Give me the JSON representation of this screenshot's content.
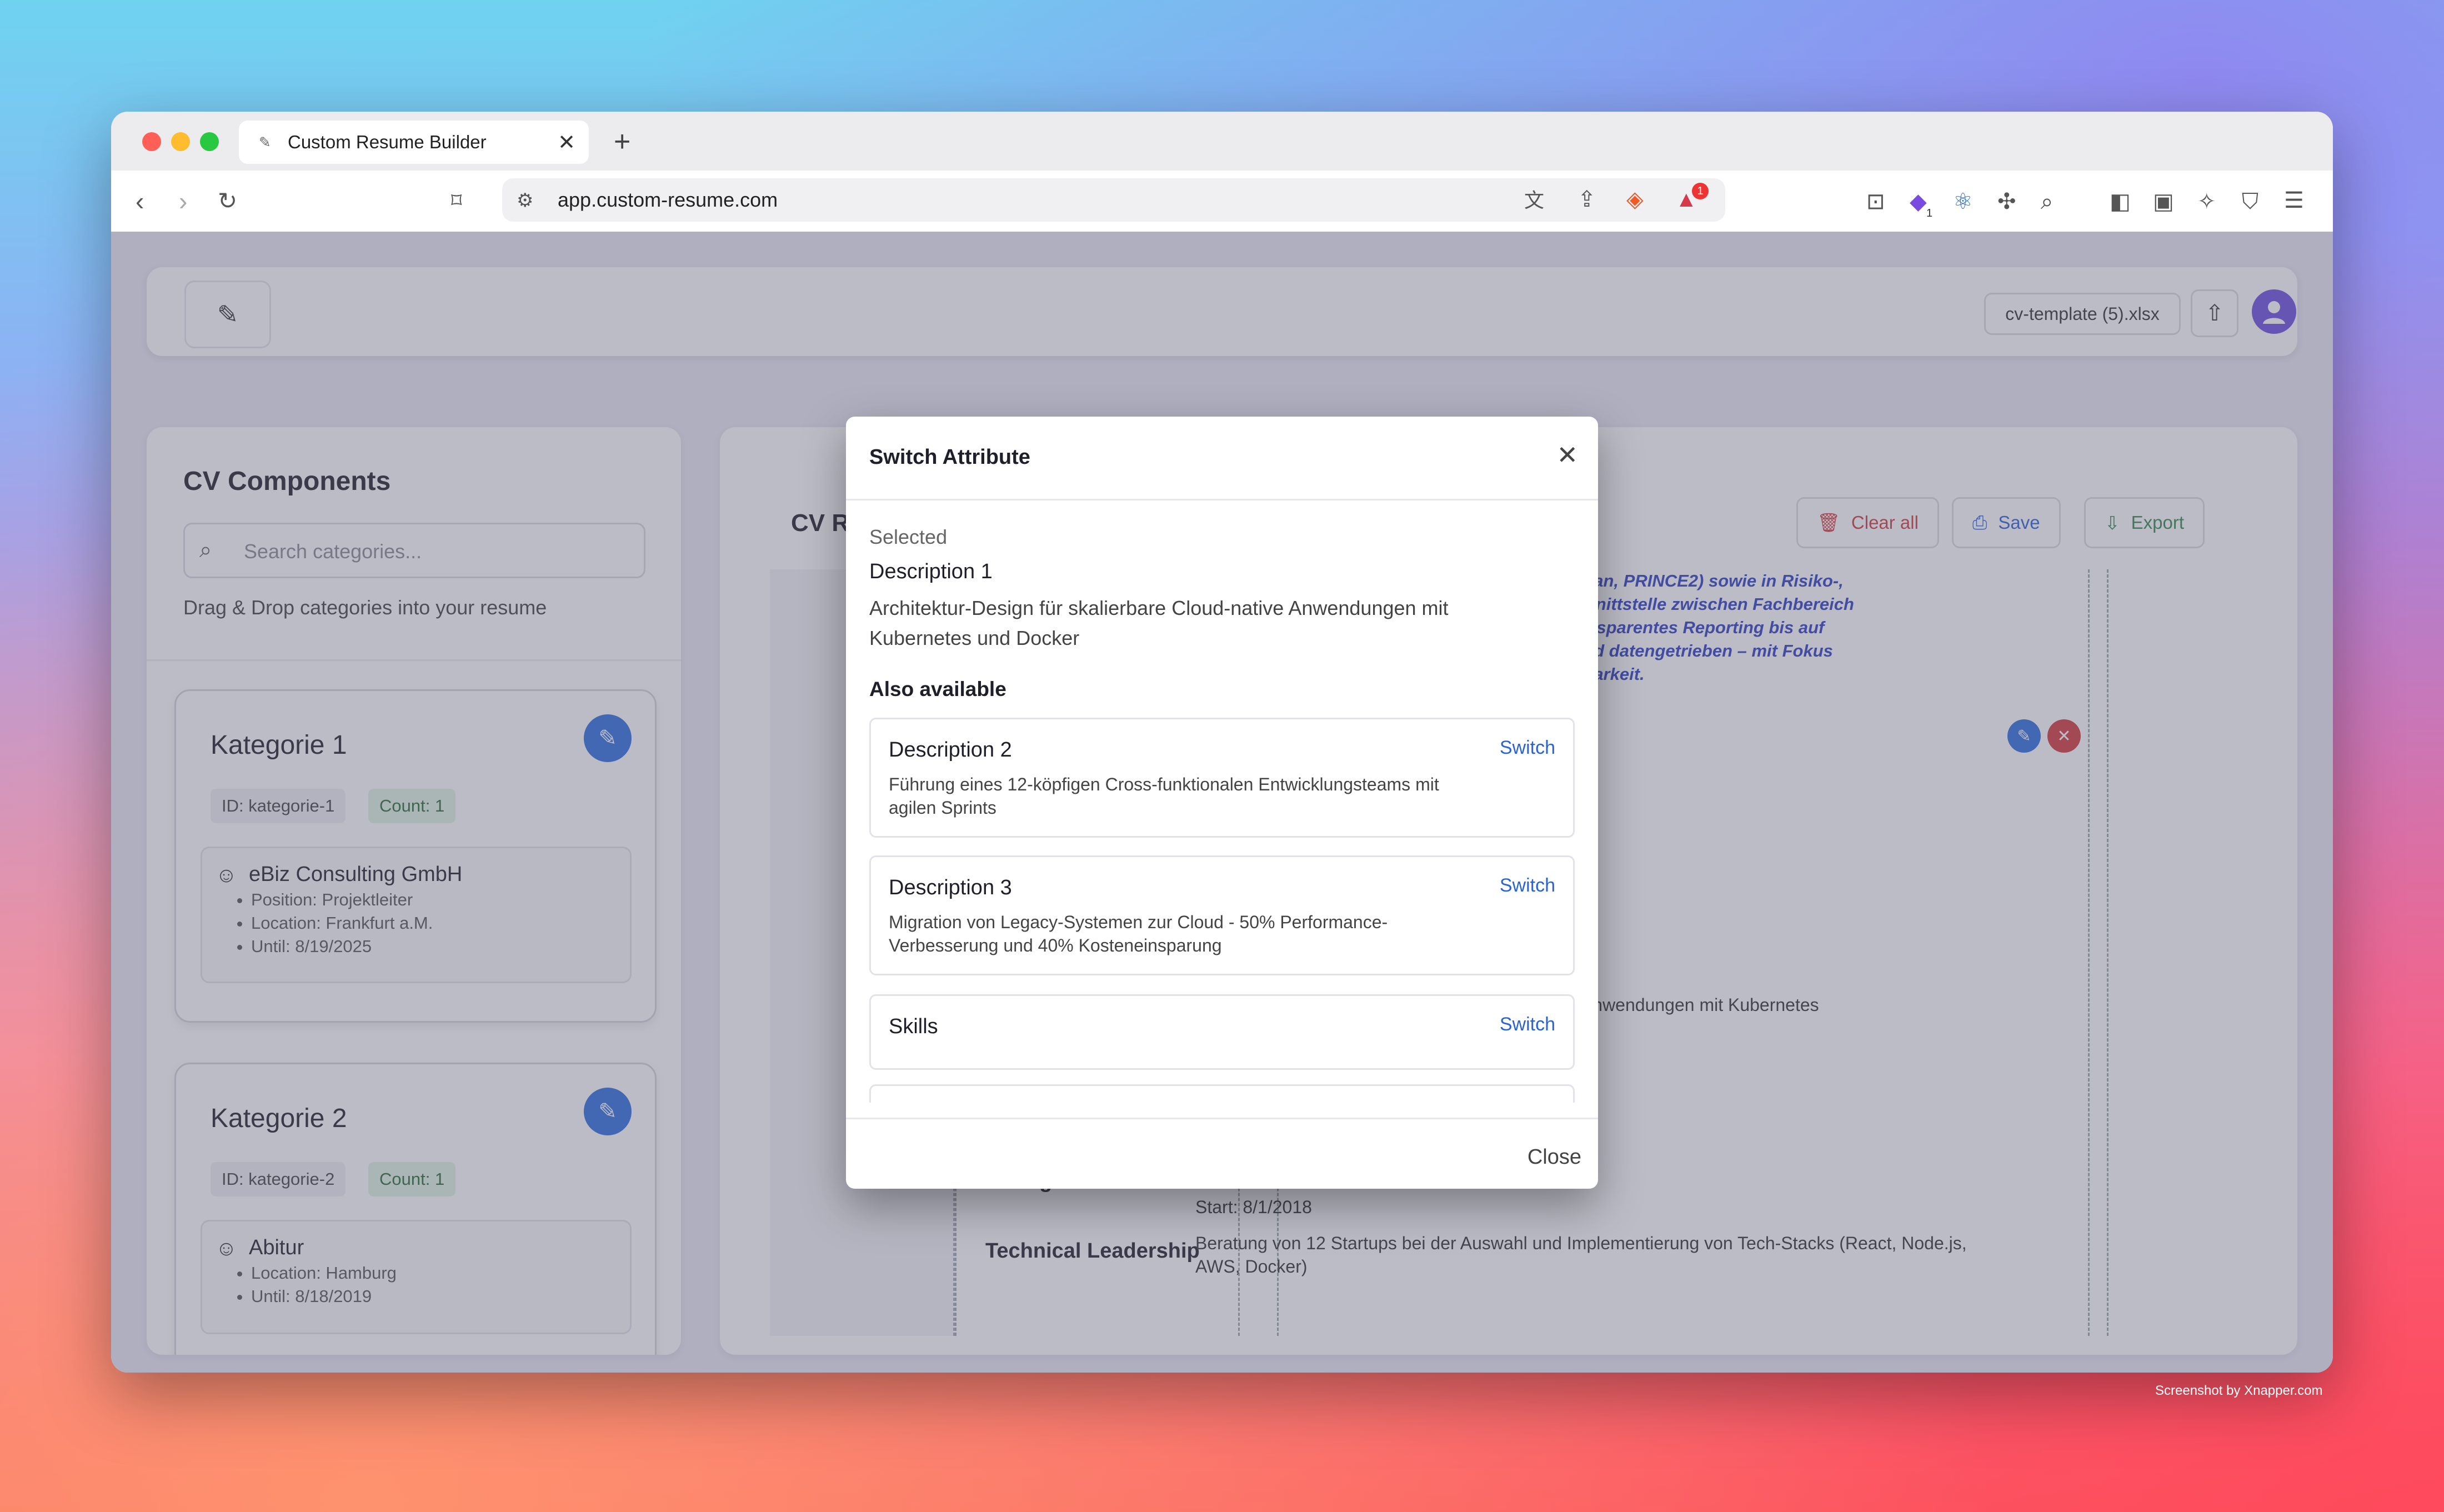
{
  "browser": {
    "tab_title": "Custom Resume Builder",
    "new_tab": "+",
    "url": "app.custom-resume.com",
    "notification_count": "1",
    "extension_badge": "1"
  },
  "header": {
    "file_name": "cv-template (5).xlsx"
  },
  "left_panel": {
    "title": "CV Components",
    "search_placeholder": "Search categories...",
    "hint": "Drag & Drop categories into your resume",
    "categories": [
      {
        "title": "Kategorie 1",
        "id": "ID: kategorie-1",
        "count": "Count: 1",
        "entry_name": "eBiz Consulting GmbH",
        "details": [
          "Position: Projektleiter",
          "Location: Frankfurt a.M.",
          "Until: 8/19/2025"
        ]
      },
      {
        "title": "Kategorie 2",
        "id": "ID: kategorie-2",
        "count": "Count: 1",
        "entry_name": "Abitur",
        "details": [
          "Location: Hamburg",
          "Until: 8/18/2019"
        ]
      }
    ]
  },
  "right_panel": {
    "title_partial": "CV R",
    "clear_all": "Clear all",
    "save": "Save",
    "export": "Export",
    "resume_lines": [
      "den (Scrum, Kanban, PRINCE2) sowie in Risiko-,",
      "ement. Starke Schnittstelle zwischen Fachbereich",
      "unikation und transparentes Reporting bis auf",
      "en, strukturiert und datengetrieben – mit Fokus",
      "chhaltige Skalierbarkeit."
    ],
    "partial_line_1": "are Cloud-native Anwendungen mit Kubernetes",
    "partial_line_2": "d",
    "section_label_1": "Management",
    "section_label_2": "Technical Leadership",
    "start_date": "Start: 8/1/2018",
    "description": "Beratung von 12 Startups bei der Auswahl und Implementierung von Tech-Stacks (React, Node.js, AWS, Docker)"
  },
  "modal": {
    "title": "Switch Attribute",
    "selected_label": "Selected",
    "selected_name": "Description 1",
    "selected_text": "Architektur-Design für skalierbare Cloud-native Anwendungen mit Kubernetes und Docker",
    "also_available": "Also available",
    "options": [
      {
        "name": "Description 2",
        "text": "Führung eines 12-köpfigen Cross-funktionalen Entwicklungsteams mit agilen Sprints",
        "action": "Switch"
      },
      {
        "name": "Description 3",
        "text": "Migration von Legacy-Systemen zur Cloud - 50% Performance-Verbesserung und 40% Kosteneinsparung",
        "action": "Switch"
      },
      {
        "name": "Skills",
        "text": "",
        "action": "Switch"
      }
    ],
    "close": "Close"
  },
  "watermark": "Screenshot by Xnapper.com",
  "colors": {
    "accent_blue": "#2f6fdf",
    "danger_red": "#d23a3a",
    "success_green": "#2f8a45"
  }
}
